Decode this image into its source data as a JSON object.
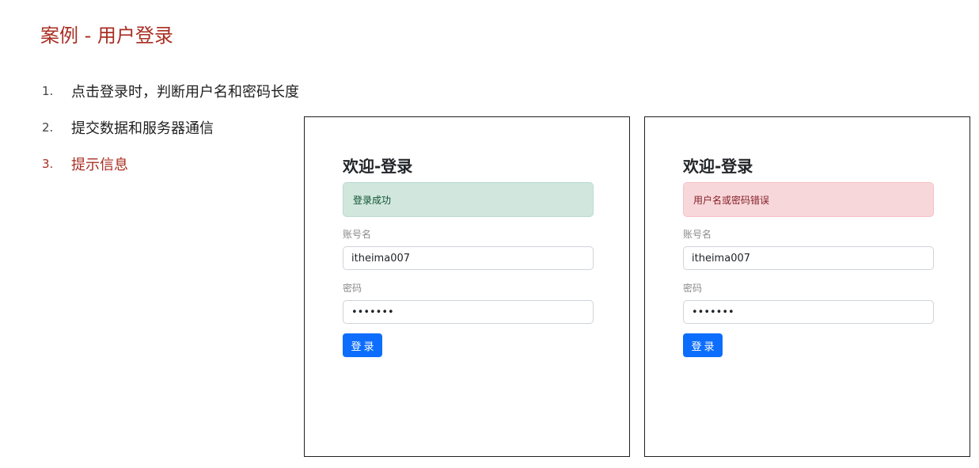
{
  "slide": {
    "title": "案例 - 用户登录"
  },
  "steps": [
    {
      "num": "1.",
      "text": "点击登录时，判断用户名和密码长度"
    },
    {
      "num": "2.",
      "text": "提交数据和服务器通信"
    },
    {
      "num": "3.",
      "text": "提示信息"
    }
  ],
  "colors": {
    "accent": "#a92e22",
    "primary_button": "#0d6efd",
    "success_bg": "#d1e7dd",
    "danger_bg": "#f8d7da"
  },
  "panel_success": {
    "heading": "欢迎-登录",
    "alert": "登录成功",
    "username_label": "账号名",
    "username_value": "itheima007",
    "password_label": "密码",
    "password_value": "1234567",
    "button_label": "登录"
  },
  "panel_error": {
    "heading": "欢迎-登录",
    "alert": "用户名或密码错误",
    "username_label": "账号名",
    "username_value": "itheima007",
    "password_label": "密码",
    "password_value": "1234567",
    "button_label": "登录"
  }
}
